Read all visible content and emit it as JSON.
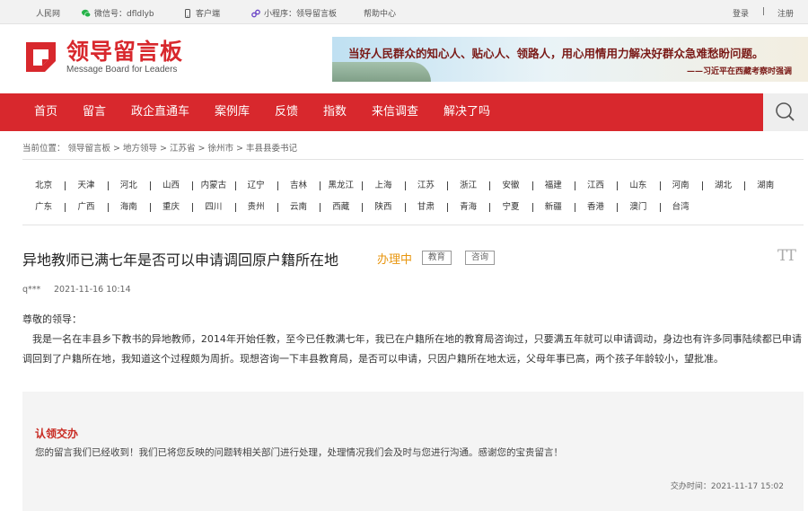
{
  "topbar": {
    "people_link": "人民网",
    "wechat_label": "微信号：dfldlyb",
    "client_label": "客户端",
    "miniprogram_label": "小程序：领导留言板",
    "help_link": "帮助中心",
    "login": "登录",
    "separator": "|",
    "register": "注册"
  },
  "logo": {
    "cn": "领导留言板",
    "en": "Message Board for Leaders"
  },
  "banner": {
    "quote": "当好人民群众的知心人、贴心人、领路人，用心用情用力解决好群众急难愁盼问题。",
    "attribution": "——习近平在西藏考察时强调"
  },
  "nav": {
    "items": [
      "首页",
      "留言",
      "政企直通车",
      "案例库",
      "反馈",
      "指数",
      "来信调查",
      "解决了吗"
    ]
  },
  "breadcrumb": {
    "prefix": "当前位置：",
    "items": [
      "领导留言板",
      ">",
      "地方领导",
      ">",
      "江苏省",
      ">",
      "徐州市",
      ">",
      "丰县县委书记"
    ]
  },
  "provinces": {
    "row1": [
      "北京",
      "天津",
      "河北",
      "山西",
      "内蒙古",
      "辽宁",
      "吉林",
      "黑龙江",
      "上海",
      "江苏",
      "浙江",
      "安徽",
      "福建",
      "江西",
      "山东",
      "河南",
      "湖北",
      "湖南"
    ],
    "row2": [
      "广东",
      "广西",
      "海南",
      "重庆",
      "四川",
      "贵州",
      "云南",
      "西藏",
      "陕西",
      "甘肃",
      "青海",
      "宁夏",
      "新疆",
      "香港",
      "澳门",
      "台湾"
    ]
  },
  "message": {
    "title": "异地教师已满七年是否可以申请调回原户籍所在地",
    "status": "办理中",
    "tags": [
      "教育",
      "咨询"
    ],
    "font_control": "TT",
    "author": "q***",
    "date": "2021-11-16 10:14",
    "greeting": "尊敬的领导：",
    "body": "我是一名在丰县乡下教书的异地教师，2014年开始任教，至今已任教满七年，我已在户籍所在地的教育局咨询过，只要满五年就可以申请调动，身边也有许多同事陆续都已申请调回到了户籍所在地，我知道这个过程颇为周折。现想咨询一下丰县教育局，是否可以申请，只因户籍所在地太远，父母年事已高，两个孩子年龄较小，望批准。"
  },
  "reply": {
    "heading": "认领交办",
    "text": "您的留言我们已经收到！我们已将您反映的问题转相关部门进行处理，处理情况我们会及时与您进行沟通。感谢您的宝贵留言！",
    "time": "交办时间：2021-11-17 15:02"
  },
  "colors": {
    "brand_red": "#d8282d",
    "status_orange": "#e8960f",
    "reply_heading": "#c82a22"
  }
}
